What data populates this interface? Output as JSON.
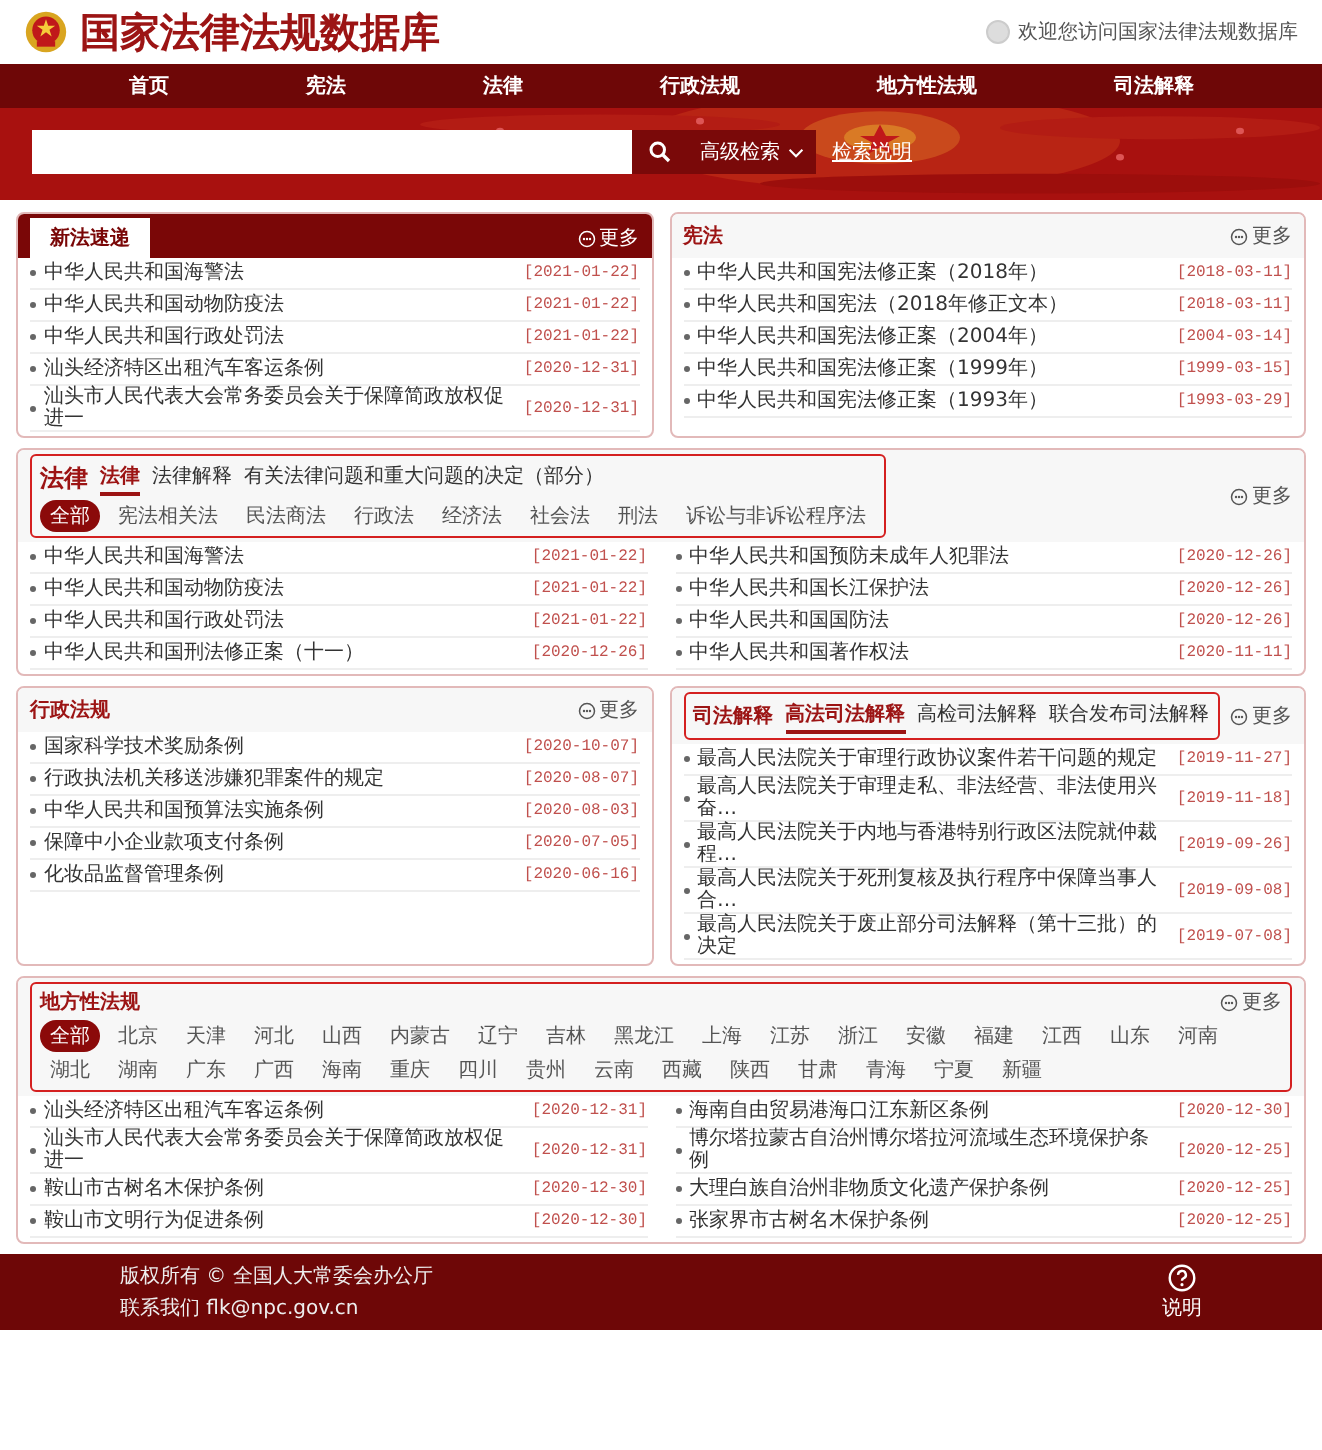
{
  "header": {
    "site_title": "国家法律法规数据库",
    "welcome": "欢迎您访问国家法律法规数据库"
  },
  "nav": [
    {
      "label": "首页"
    },
    {
      "label": "宪法"
    },
    {
      "label": "法律"
    },
    {
      "label": "行政法规"
    },
    {
      "label": "地方性法规"
    },
    {
      "label": "司法解释"
    }
  ],
  "search": {
    "advanced_label": "高级检索",
    "help_link": "检索说明"
  },
  "new_laws": {
    "title": "新法速递",
    "more": "更多",
    "items": [
      {
        "title": "中华人民共和国海警法",
        "date": "[2021-01-22]"
      },
      {
        "title": "中华人民共和国动物防疫法",
        "date": "[2021-01-22]"
      },
      {
        "title": "中华人民共和国行政处罚法",
        "date": "[2021-01-22]"
      },
      {
        "title": "汕头经济特区出租汽车客运条例",
        "date": "[2020-12-31]"
      },
      {
        "title": "汕头市人民代表大会常务委员会关于保障简政放权促进一",
        "date": "[2020-12-31]"
      }
    ]
  },
  "constitution": {
    "title": "宪法",
    "more": "更多",
    "items": [
      {
        "title": "中华人民共和国宪法修正案（2018年）",
        "date": "[2018-03-11]"
      },
      {
        "title": "中华人民共和国宪法（2018年修正文本）",
        "date": "[2018-03-11]"
      },
      {
        "title": "中华人民共和国宪法修正案（2004年）",
        "date": "[2004-03-14]"
      },
      {
        "title": "中华人民共和国宪法修正案（1999年）",
        "date": "[1999-03-15]"
      },
      {
        "title": "中华人民共和国宪法修正案（1993年）",
        "date": "[1993-03-29]"
      }
    ]
  },
  "laws": {
    "title": "法律",
    "more": "更多",
    "tabs": [
      {
        "label": "法律",
        "selected": true
      },
      {
        "label": "法律解释",
        "selected": false
      },
      {
        "label": "有关法律问题和重大问题的决定（部分）",
        "selected": false
      }
    ],
    "categories": [
      {
        "label": "全部",
        "selected": true
      },
      {
        "label": "宪法相关法",
        "selected": false
      },
      {
        "label": "民法商法",
        "selected": false
      },
      {
        "label": "行政法",
        "selected": false
      },
      {
        "label": "经济法",
        "selected": false
      },
      {
        "label": "社会法",
        "selected": false
      },
      {
        "label": "刑法",
        "selected": false
      },
      {
        "label": "诉讼与非诉讼程序法",
        "selected": false
      }
    ],
    "items": [
      {
        "title": "中华人民共和国海警法",
        "date": "[2021-01-22]"
      },
      {
        "title": "中华人民共和国预防未成年人犯罪法",
        "date": "[2020-12-26]"
      },
      {
        "title": "中华人民共和国动物防疫法",
        "date": "[2021-01-22]"
      },
      {
        "title": "中华人民共和国长江保护法",
        "date": "[2020-12-26]"
      },
      {
        "title": "中华人民共和国行政处罚法",
        "date": "[2021-01-22]"
      },
      {
        "title": "中华人民共和国国防法",
        "date": "[2020-12-26]"
      },
      {
        "title": "中华人民共和国刑法修正案（十一）",
        "date": "[2020-12-26]"
      },
      {
        "title": "中华人民共和国著作权法",
        "date": "[2020-11-11]"
      }
    ]
  },
  "admin_regulations": {
    "title": "行政法规",
    "more": "更多",
    "items": [
      {
        "title": "国家科学技术奖励条例",
        "date": "[2020-10-07]"
      },
      {
        "title": "行政执法机关移送涉嫌犯罪案件的规定",
        "date": "[2020-08-07]"
      },
      {
        "title": "中华人民共和国预算法实施条例",
        "date": "[2020-08-03]"
      },
      {
        "title": "保障中小企业款项支付条例",
        "date": "[2020-07-05]"
      },
      {
        "title": "化妆品监督管理条例",
        "date": "[2020-06-16]"
      }
    ]
  },
  "judicial": {
    "title": "司法解释",
    "more": "更多",
    "tabs": [
      {
        "label": "高法司法解释",
        "selected": true
      },
      {
        "label": "高检司法解释",
        "selected": false
      },
      {
        "label": "联合发布司法解释",
        "selected": false
      }
    ],
    "items": [
      {
        "title": "最高人民法院关于审理行政协议案件若干问题的规定",
        "date": "[2019-11-27]"
      },
      {
        "title": "最高人民法院关于审理走私、非法经营、非法使用兴奋…",
        "date": "[2019-11-18]"
      },
      {
        "title": "最高人民法院关于内地与香港特别行政区法院就仲裁程…",
        "date": "[2019-09-26]"
      },
      {
        "title": "最高人民法院关于死刑复核及执行程序中保障当事人合…",
        "date": "[2019-09-08]"
      },
      {
        "title": "最高人民法院关于废止部分司法解释（第十三批）的决定",
        "date": "[2019-07-08]"
      }
    ]
  },
  "local_regulations": {
    "title": "地方性法规",
    "more": "更多",
    "regions": [
      {
        "label": "全部",
        "selected": true
      },
      {
        "label": "北京",
        "selected": false
      },
      {
        "label": "天津",
        "selected": false
      },
      {
        "label": "河北",
        "selected": false
      },
      {
        "label": "山西",
        "selected": false
      },
      {
        "label": "内蒙古",
        "selected": false
      },
      {
        "label": "辽宁",
        "selected": false
      },
      {
        "label": "吉林",
        "selected": false
      },
      {
        "label": "黑龙江",
        "selected": false
      },
      {
        "label": "上海",
        "selected": false
      },
      {
        "label": "江苏",
        "selected": false
      },
      {
        "label": "浙江",
        "selected": false
      },
      {
        "label": "安徽",
        "selected": false
      },
      {
        "label": "福建",
        "selected": false
      },
      {
        "label": "江西",
        "selected": false
      },
      {
        "label": "山东",
        "selected": false
      },
      {
        "label": "河南",
        "selected": false
      },
      {
        "label": "湖北",
        "selected": false
      },
      {
        "label": "湖南",
        "selected": false
      },
      {
        "label": "广东",
        "selected": false
      },
      {
        "label": "广西",
        "selected": false
      },
      {
        "label": "海南",
        "selected": false
      },
      {
        "label": "重庆",
        "selected": false
      },
      {
        "label": "四川",
        "selected": false
      },
      {
        "label": "贵州",
        "selected": false
      },
      {
        "label": "云南",
        "selected": false
      },
      {
        "label": "西藏",
        "selected": false
      },
      {
        "label": "陕西",
        "selected": false
      },
      {
        "label": "甘肃",
        "selected": false
      },
      {
        "label": "青海",
        "selected": false
      },
      {
        "label": "宁夏",
        "selected": false
      },
      {
        "label": "新疆",
        "selected": false
      }
    ],
    "items": [
      {
        "title": "汕头经济特区出租汽车客运条例",
        "date": "[2020-12-31]"
      },
      {
        "title": "海南自由贸易港海口江东新区条例",
        "date": "[2020-12-30]"
      },
      {
        "title": "汕头市人民代表大会常务委员会关于保障简政放权促进一",
        "date": "[2020-12-31]"
      },
      {
        "title": "博尔塔拉蒙古自治州博尔塔拉河流域生态环境保护条例",
        "date": "[2020-12-25]"
      },
      {
        "title": "鞍山市古树名木保护条例",
        "date": "[2020-12-30]"
      },
      {
        "title": "大理白族自治州非物质文化遗产保护条例",
        "date": "[2020-12-25]"
      },
      {
        "title": "鞍山市文明行为促进条例",
        "date": "[2020-12-30]"
      },
      {
        "title": "张家界市古树名木保护条例",
        "date": "[2020-12-25]"
      }
    ]
  },
  "footer": {
    "copyright": "版权所有 © 全国人大常委会办公厅",
    "contact": "联系我们 flk@npc.gov.cn",
    "help_label": "说明"
  }
}
